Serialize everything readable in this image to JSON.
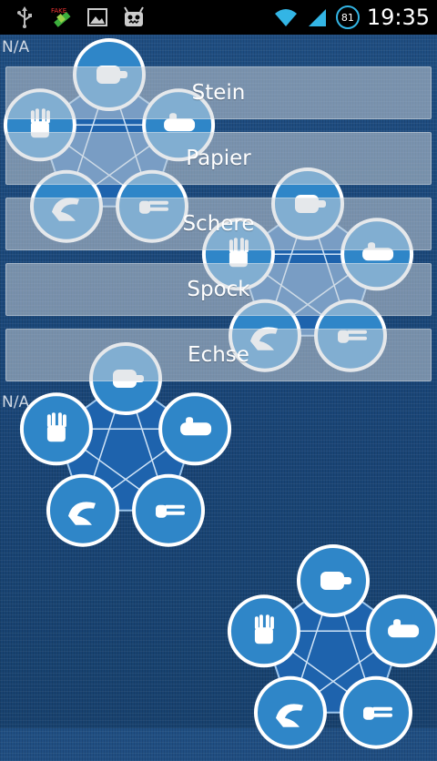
{
  "status_bar": {
    "time": "19:35",
    "battery_level": "81",
    "icons": [
      "usb-icon",
      "satellite-fake-gps-icon",
      "image-icon",
      "android-icon",
      "wifi-icon",
      "signal-icon",
      "battery-icon"
    ],
    "fake_label": "FAKE"
  },
  "labels": {
    "top_status": "N/A",
    "bottom_status": "N/A"
  },
  "buttons": [
    {
      "id": "stein",
      "label": "Stein"
    },
    {
      "id": "papier",
      "label": "Papier"
    },
    {
      "id": "schere",
      "label": "Schere"
    },
    {
      "id": "spock",
      "label": "Spock"
    },
    {
      "id": "echse",
      "label": "Echse"
    }
  ],
  "diagram": {
    "icons": [
      "rock-hand-icon",
      "paper-hand-icon",
      "scissors-hand-icon",
      "lizard-hand-icon",
      "spock-hand-icon"
    ]
  },
  "colors": {
    "circle_fill": "#2f86c8",
    "circle_border": "#ffffff",
    "pentagon_fill": "#1e63ad",
    "button_bg": "rgba(205,210,216,0.52)"
  }
}
